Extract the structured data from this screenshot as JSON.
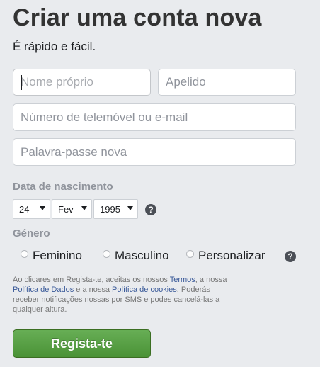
{
  "header": {
    "title": "Criar uma conta nova",
    "subtitle": "É rápido e fácil."
  },
  "form": {
    "first_name_placeholder": "Nome próprio",
    "last_name_placeholder": "Apelido",
    "contact_placeholder": "Número de telemóvel ou e-mail",
    "password_placeholder": "Palavra-passe nova"
  },
  "birthday": {
    "label": "Data de nascimento",
    "day": "24",
    "month": "Fev",
    "year": "1995",
    "help_icon": "question-circle-icon",
    "help_glyph": "?"
  },
  "gender": {
    "label": "Género",
    "options": [
      "Feminino",
      "Masculino",
      "Personalizar"
    ],
    "help_glyph": "?"
  },
  "terms": {
    "part1": "Ao clicares em Regista-te, aceitas os nossos ",
    "link_terms": "Termos",
    "part2": ", a nossa ",
    "link_data_policy": "Política de Dados",
    "part3": " e a nossa ",
    "link_cookie_policy": "Política de cookies",
    "part4": ". Poderás receber notificações nossas por SMS e podes cancelá-las a qualquer altura."
  },
  "submit_label": "Regista-te",
  "colors": {
    "background": "#e9ebee",
    "link": "#385898",
    "button_green": "#4a9236"
  }
}
